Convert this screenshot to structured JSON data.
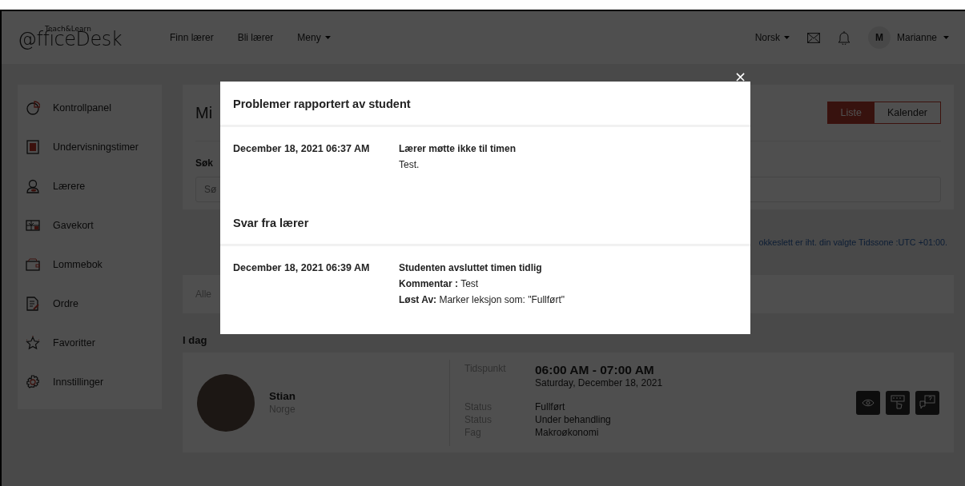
{
  "header": {
    "logo_small": "Teach&Learn",
    "logo": "@fficeDesk",
    "nav": [
      {
        "label": "Finn lærer",
        "kind": "link"
      },
      {
        "label": "Bli lærer",
        "kind": "link"
      },
      {
        "label": "Meny",
        "kind": "dropdown"
      }
    ],
    "language": "Norsk",
    "avatar_initial": "M",
    "user": "Marianne"
  },
  "sidebar": {
    "items": [
      {
        "label": "Kontrollpanel"
      },
      {
        "label": "Undervisningstimer"
      },
      {
        "label": "Lærere"
      },
      {
        "label": "Gavekort"
      },
      {
        "label": "Lommebok"
      },
      {
        "label": "Ordre"
      },
      {
        "label": "Favoritter"
      },
      {
        "label": "Innstillinger"
      }
    ]
  },
  "page": {
    "title": "Mi",
    "view_toggle": [
      {
        "label": "Liste",
        "selected": true
      },
      {
        "label": "Kalender",
        "selected": false
      }
    ],
    "search_label": "Søk",
    "search_placeholder": "Sø",
    "timezone_note": "okkeslett er iht. din valgte Tidssone :UTC +01:00.",
    "filter": "Alle",
    "section": "I dag"
  },
  "lesson": {
    "name": "Stian",
    "country": "Norge",
    "fields": [
      {
        "label": "Tidspunkt",
        "value": "06:00 AM - 07:00 AM",
        "kind": "time",
        "sub": "Saturday, December 18, 2021"
      },
      {
        "label": "Status",
        "value": "Fullført",
        "kind": "plain"
      },
      {
        "label": "Status",
        "value": "Under behandling",
        "kind": "plain"
      },
      {
        "label": "Fag",
        "value": "Makroøkonomi",
        "kind": "plain"
      }
    ]
  },
  "modal": {
    "close": "×",
    "sections": [
      {
        "title": "Problemer rapportert av student",
        "entries": [
          {
            "date": "December 18, 2021 06:37 AM",
            "heading": "Lærer møtte ikke til timen",
            "lines": [
              "Test."
            ]
          }
        ]
      },
      {
        "title": "Svar fra lærer",
        "entries": [
          {
            "date": "December 18, 2021 06:39 AM",
            "heading": "Studenten avsluttet timen tidlig",
            "lines": [
              "**Kommentar :** Test",
              "**Løst Av:** Marker leksjon som: \"Fullført\""
            ]
          }
        ]
      }
    ]
  }
}
